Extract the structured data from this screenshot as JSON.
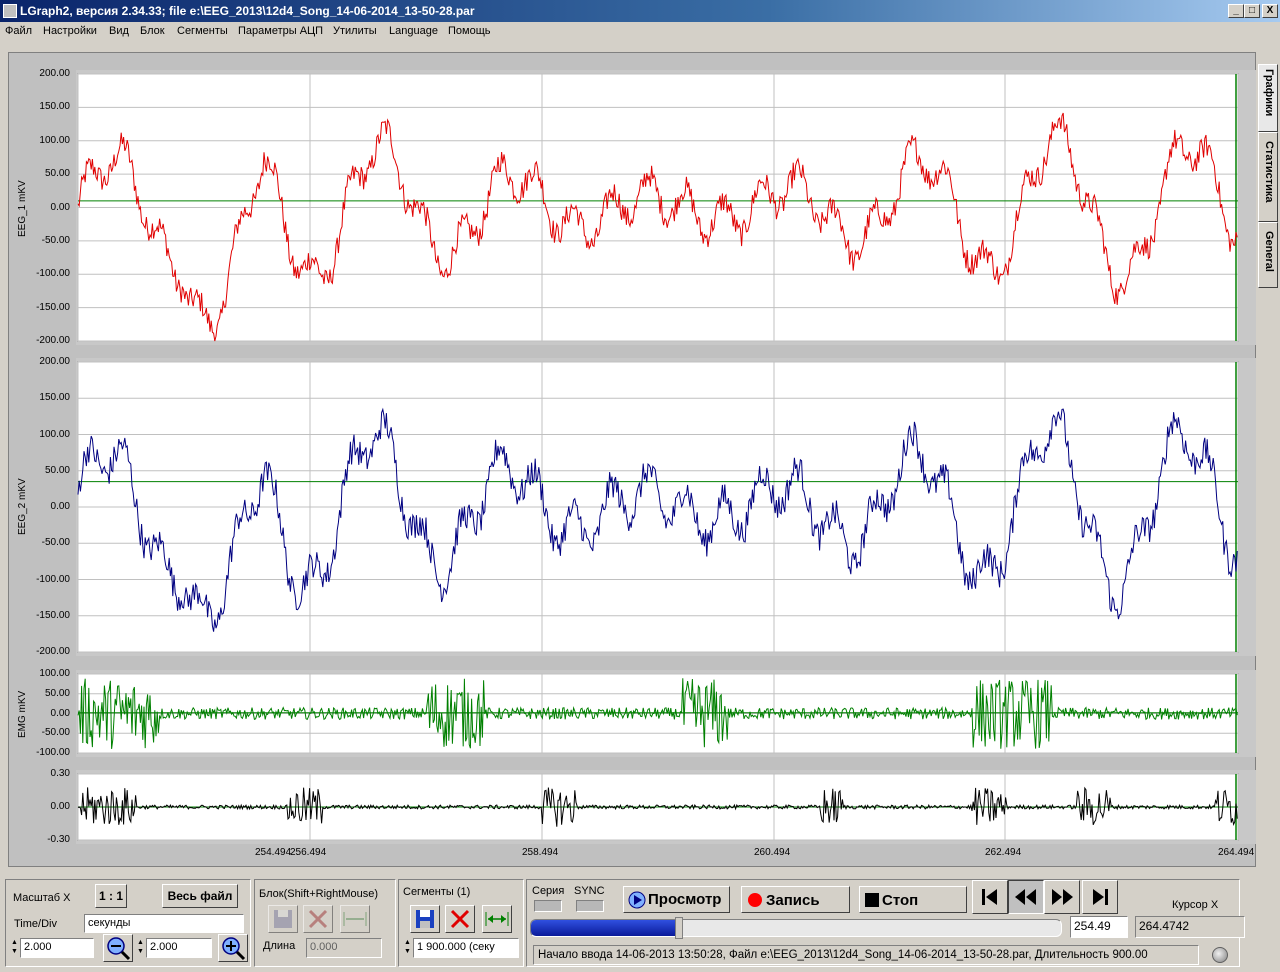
{
  "window": {
    "title": "LGraph2, версия  2.34.33; file e:\\EEG_2013\\12d4_Song_14-06-2014_13-50-28.par",
    "controls": [
      "_",
      "□",
      "X"
    ]
  },
  "menu": [
    "Файл",
    "Настройки",
    "Вид",
    "Блок",
    "Сегменты",
    "Параметры АЦП",
    "Утилиты",
    "Language",
    "Помощь"
  ],
  "side_tabs": [
    "Графики",
    "Статистика",
    "General"
  ],
  "channels": [
    {
      "name": "EEG_1 mKV",
      "color": "#e00000",
      "ticks": [
        "200.00",
        "150.00",
        "100.00",
        "50.00",
        "0.00",
        "-50.00",
        "-100.00",
        "-150.00",
        "-200.00"
      ],
      "ymin": -200,
      "ymax": 200,
      "ref": 10
    },
    {
      "name": "EEG_2 mKV",
      "color": "#000080",
      "ticks": [
        "200.00",
        "150.00",
        "100.00",
        "50.00",
        "0.00",
        "-50.00",
        "-100.00",
        "-150.00",
        "-200.00"
      ],
      "ymin": -200,
      "ymax": 200,
      "ref": 35
    },
    {
      "name": "EMG mKV",
      "color": "#008000",
      "ticks": [
        "100.00",
        "50.00",
        "0.00",
        "-50.00",
        "-100.00"
      ],
      "ymin": -100,
      "ymax": 100,
      "ref": 2
    },
    {
      "name": "",
      "color": "#000000",
      "ticks": [
        "0.30",
        "0.00",
        "-0.30"
      ],
      "ymin": -0.3,
      "ymax": 0.3,
      "ref": 0
    }
  ],
  "x_ticks": [
    "254.494",
    "256.494",
    "258.494",
    "260.494",
    "262.494",
    "264.494"
  ],
  "controls": {
    "scale_x_label": "Масштаб X",
    "ratio_button": "1 : 1",
    "whole_file_button": "Весь файл",
    "timediv_label": "Time/Div",
    "units_value": "секунды",
    "value_a": "2.000",
    "value_b": "2.000",
    "block_title": "Блок(Shift+RightMouse)",
    "length_label": "Длина",
    "length_value": "0.000",
    "segments_title": "Сегменты (1)",
    "segment_value": "1   900.000 (секу",
    "series_label": "Серия",
    "sync_label": "SYNC",
    "view_button": "Просмотр",
    "record_button": "Запись",
    "stop_button": "Стоп",
    "cursor_label": "Курсор X",
    "position_value": "254.49",
    "cursor_value": "264.4742",
    "progress": 0.28,
    "status_text": "Начало ввода   14-06-2013 13:50:28, Файл e:\\EEG_2013\\12d4_Song_14-06-2014_13-50-28.par, Длительность 900.00"
  }
}
